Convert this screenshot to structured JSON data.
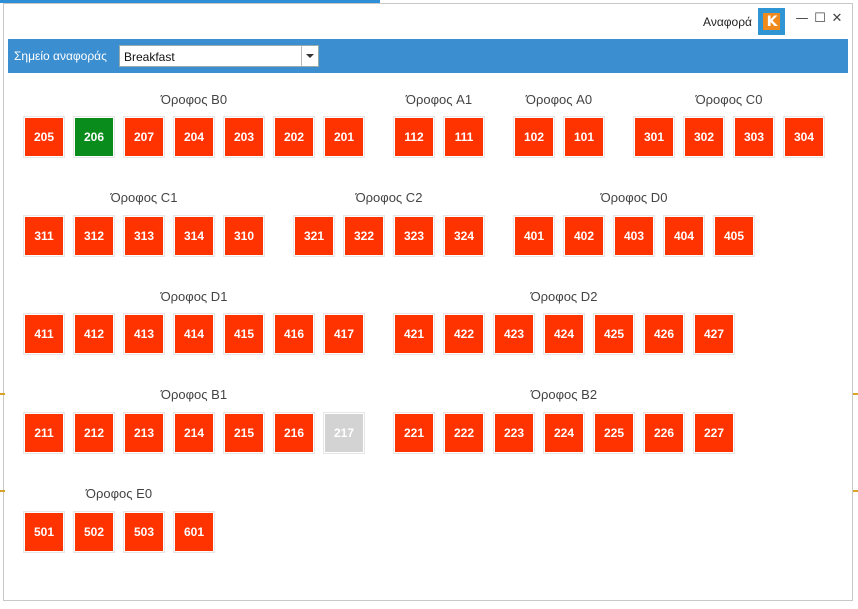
{
  "window": {
    "title": "Αναφορά",
    "logo_text": "K",
    "minimize": "—",
    "maximize": "☐",
    "close": "✕"
  },
  "toolbar": {
    "label": "Σημείο αναφοράς",
    "select_value": "Breakfast"
  },
  "colors": {
    "occupied": "#ff3300",
    "done": "#0a8c1c",
    "disabled": "#d3d3d3",
    "toolbar": "#3b8ed0"
  },
  "floors": [
    {
      "name": "Όροφος B0",
      "rooms": [
        {
          "n": "205",
          "s": "red"
        },
        {
          "n": "206",
          "s": "green"
        },
        {
          "n": "207",
          "s": "red"
        },
        {
          "n": "204",
          "s": "red"
        },
        {
          "n": "203",
          "s": "red"
        },
        {
          "n": "202",
          "s": "red"
        },
        {
          "n": "201",
          "s": "red"
        }
      ]
    },
    {
      "name": "Όροφος A1",
      "rooms": [
        {
          "n": "112",
          "s": "red"
        },
        {
          "n": "111",
          "s": "red"
        }
      ]
    },
    {
      "name": "Όροφος A0",
      "rooms": [
        {
          "n": "102",
          "s": "red"
        },
        {
          "n": "101",
          "s": "red"
        }
      ]
    },
    {
      "name": "Όροφος C0",
      "rooms": [
        {
          "n": "301",
          "s": "red"
        },
        {
          "n": "302",
          "s": "red"
        },
        {
          "n": "303",
          "s": "red"
        },
        {
          "n": "304",
          "s": "red"
        }
      ]
    },
    {
      "name": "Όροφος C1",
      "rooms": [
        {
          "n": "311",
          "s": "red"
        },
        {
          "n": "312",
          "s": "red"
        },
        {
          "n": "313",
          "s": "red"
        },
        {
          "n": "314",
          "s": "red"
        },
        {
          "n": "310",
          "s": "red"
        }
      ]
    },
    {
      "name": "Όροφος C2",
      "rooms": [
        {
          "n": "321",
          "s": "red"
        },
        {
          "n": "322",
          "s": "red"
        },
        {
          "n": "323",
          "s": "red"
        },
        {
          "n": "324",
          "s": "red"
        }
      ]
    },
    {
      "name": "Όροφος D0",
      "rooms": [
        {
          "n": "401",
          "s": "red"
        },
        {
          "n": "402",
          "s": "red"
        },
        {
          "n": "403",
          "s": "red"
        },
        {
          "n": "404",
          "s": "red"
        },
        {
          "n": "405",
          "s": "red"
        }
      ]
    },
    {
      "name": "Όροφος D1",
      "rooms": [
        {
          "n": "411",
          "s": "red"
        },
        {
          "n": "412",
          "s": "red"
        },
        {
          "n": "413",
          "s": "red"
        },
        {
          "n": "414",
          "s": "red"
        },
        {
          "n": "415",
          "s": "red"
        },
        {
          "n": "416",
          "s": "red"
        },
        {
          "n": "417",
          "s": "red"
        }
      ]
    },
    {
      "name": "Όροφος D2",
      "rooms": [
        {
          "n": "421",
          "s": "red"
        },
        {
          "n": "422",
          "s": "red"
        },
        {
          "n": "423",
          "s": "red"
        },
        {
          "n": "424",
          "s": "red"
        },
        {
          "n": "425",
          "s": "red"
        },
        {
          "n": "426",
          "s": "red"
        },
        {
          "n": "427",
          "s": "red"
        }
      ]
    },
    {
      "name": "Όροφος B1",
      "rooms": [
        {
          "n": "211",
          "s": "red"
        },
        {
          "n": "212",
          "s": "red"
        },
        {
          "n": "213",
          "s": "red"
        },
        {
          "n": "214",
          "s": "red"
        },
        {
          "n": "215",
          "s": "red"
        },
        {
          "n": "216",
          "s": "red"
        },
        {
          "n": "217",
          "s": "gray"
        }
      ]
    },
    {
      "name": "Όροφος B2",
      "rooms": [
        {
          "n": "221",
          "s": "red"
        },
        {
          "n": "222",
          "s": "red"
        },
        {
          "n": "223",
          "s": "red"
        },
        {
          "n": "224",
          "s": "red"
        },
        {
          "n": "225",
          "s": "red"
        },
        {
          "n": "226",
          "s": "red"
        },
        {
          "n": "227",
          "s": "red"
        }
      ]
    },
    {
      "name": "Όροφος E0",
      "rooms": [
        {
          "n": "501",
          "s": "red"
        },
        {
          "n": "502",
          "s": "red"
        },
        {
          "n": "503",
          "s": "red"
        },
        {
          "n": "601",
          "s": "red"
        }
      ]
    }
  ]
}
